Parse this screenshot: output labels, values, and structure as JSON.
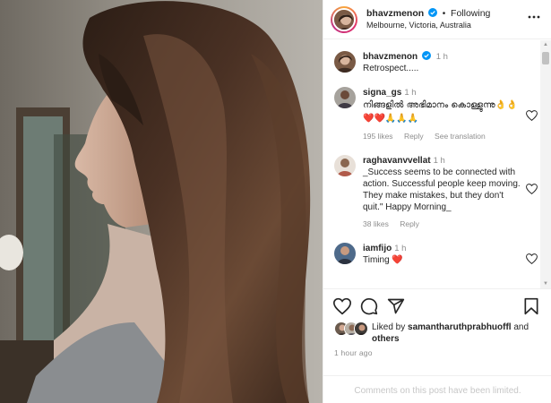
{
  "post": {
    "author": "bhavzmenon",
    "follow_status": "Following",
    "separator": "•",
    "location": "Melbourne, Victoria, Australia",
    "caption": "Retrospect.....",
    "caption_time": "1 h"
  },
  "comments": [
    {
      "user": "signa_gs",
      "time": "1 h",
      "text": "നിങ്ങളിൽ അഭിമാനം കൊള്ളുന്നു👌👌❤️❤️🙏🙏🙏",
      "likes": "195 likes",
      "reply": "Reply",
      "translate": "See translation"
    },
    {
      "user": "raghavanvvellat",
      "time": "1 h",
      "text": "_Success seems to be connected with action. Successful people keep moving. They make mistakes, but they don't quit.\" Happy Morning_",
      "likes": "38 likes",
      "reply": "Reply"
    },
    {
      "user": "iamfijo",
      "time": "1 h",
      "text": "Timing ❤️"
    }
  ],
  "likes": {
    "prefix": "Liked by",
    "user": "samantharuthprabhuoffl",
    "and": "and",
    "others": "others"
  },
  "posted_ago": "1 hour ago",
  "comments_limited": "Comments on this post have been limited.",
  "icons": [
    "verified-icon",
    "more-options-icon",
    "heart-icon",
    "comment-icon",
    "share-icon",
    "bookmark-icon"
  ],
  "colors": {
    "verified": "#0095f6",
    "heart_red": "#ed4956",
    "muted": "#8e8e8e",
    "border": "#efefef"
  }
}
